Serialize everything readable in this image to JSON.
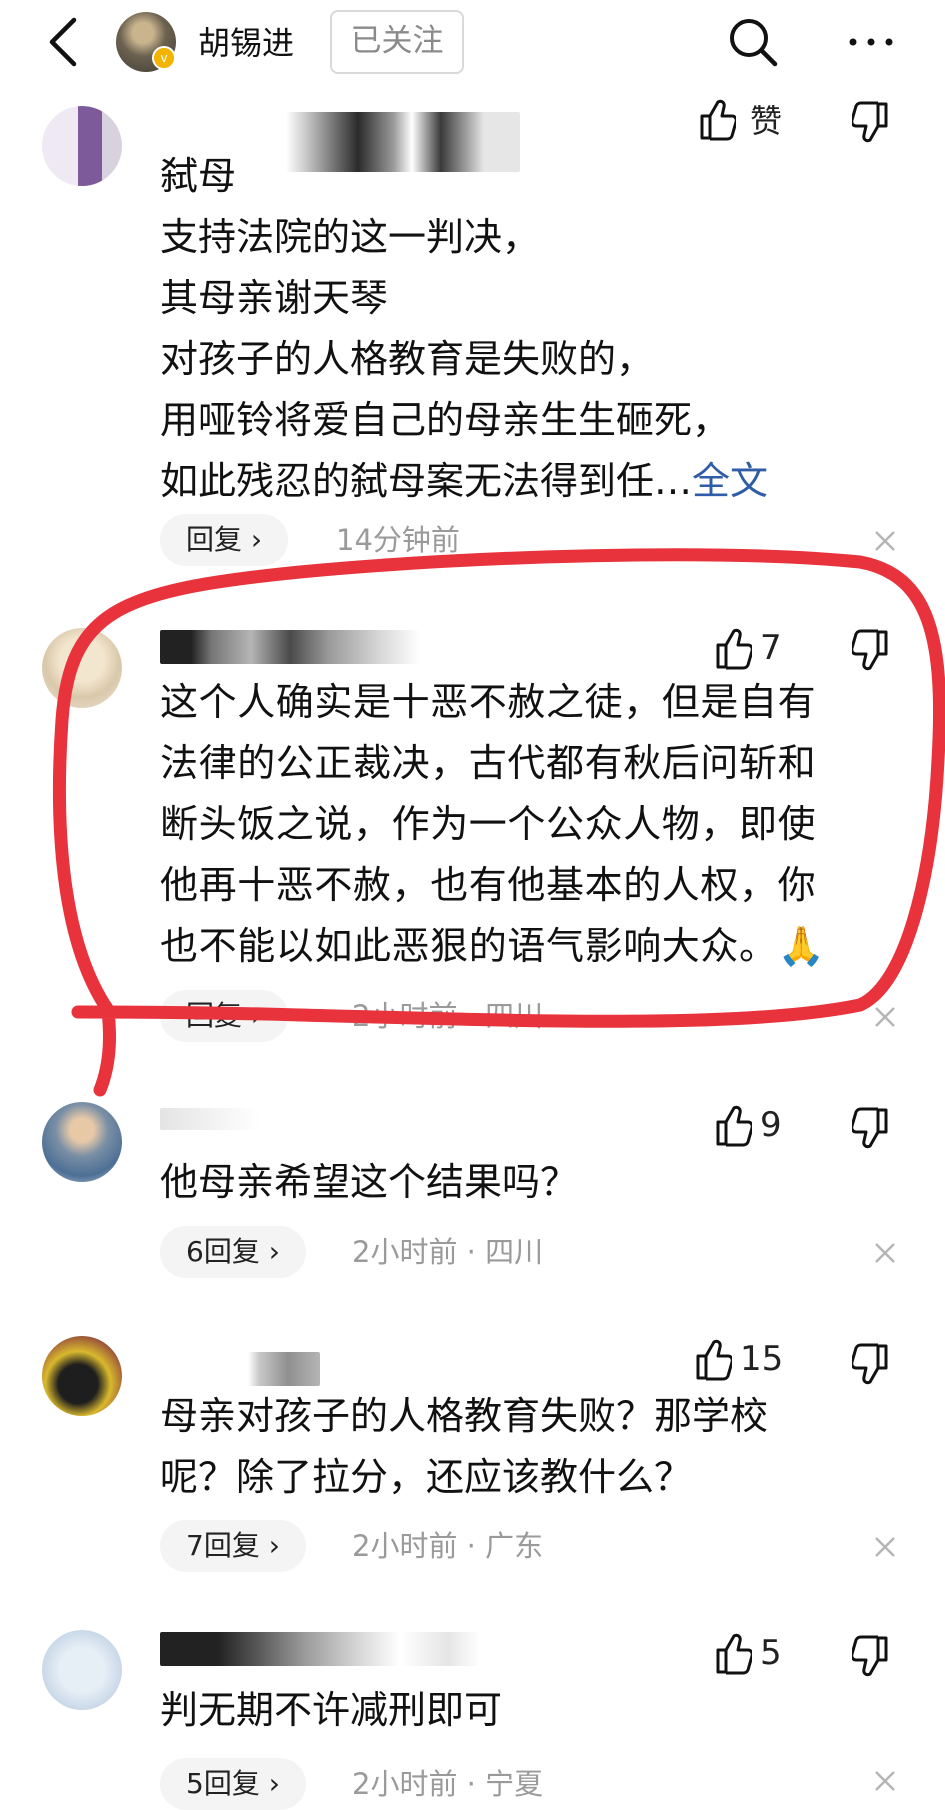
{
  "header": {
    "author_name": "胡锡进",
    "follow_label": "已关注",
    "badge": "v"
  },
  "icons": {
    "back": "back-arrow-icon",
    "search": "search-icon",
    "more": "more-icon",
    "like": "thumbs-up-icon",
    "dislike": "thumbs-down-icon",
    "close": "close-icon"
  },
  "comments": [
    {
      "lines": [
        "弑母",
        "支持法院的这一判决，",
        "其母亲谢天琴",
        "对孩子的人格教育是失败的，",
        "用哑铃将爱自己的母亲生生砸死，",
        "如此残忍的弑母案无法得到任…"
      ],
      "more_label": "全文",
      "like_label": "赞",
      "reply_label": "回复 ›",
      "time": "14分钟前"
    },
    {
      "lines": [
        "这个人确实是十恶不赦之徒，但是自有",
        "法律的公正裁决，古代都有秋后问斩和",
        "断头饭之说，作为一个公众人物，即使",
        "他再十恶不赦，也有他基本的人权，你",
        "也不能以如此恶狠的语气影响大众。🙏"
      ],
      "like_count": "7",
      "reply_label": "回复 ›",
      "time": "2小时前 · 四川"
    },
    {
      "lines": [
        "他母亲希望这个结果吗？"
      ],
      "like_count": "9",
      "reply_label": "6回复 ›",
      "time": "2小时前 · 四川"
    },
    {
      "lines": [
        "母亲对孩子的人格教育失败？那学校",
        "呢？除了拉分，还应该教什么？"
      ],
      "like_count": "15",
      "reply_label": "7回复 ›",
      "time": "2小时前 · 广东"
    },
    {
      "lines": [
        "判无期不许减刑即可"
      ],
      "like_count": "5",
      "reply_label": "5回复 ›",
      "time": "2小时前 · 宁夏"
    }
  ],
  "colors": {
    "link": "#2f5da8",
    "highlight_marker": "#e8323c",
    "meta": "#9a9a9a",
    "pill": "#f4f4f4"
  }
}
